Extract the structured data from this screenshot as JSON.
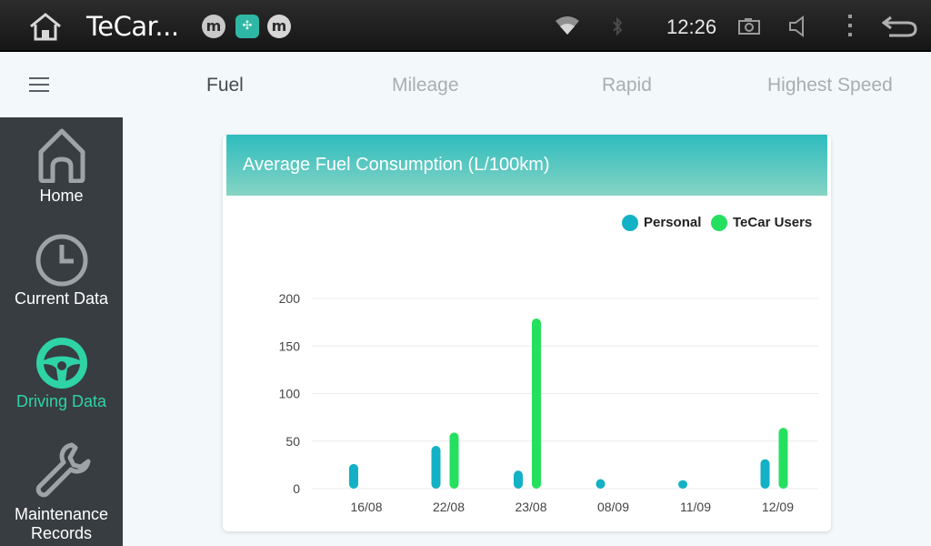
{
  "statusbar": {
    "title": "TeCar...",
    "time": "12:26",
    "notifications": [
      "m-badge-1",
      "m-badge-2",
      "m-badge-3"
    ],
    "icons": [
      "home-icon",
      "wifi-icon",
      "bluetooth-icon",
      "screenshot-icon",
      "volume-icon",
      "overflow-menu-icon",
      "back-icon"
    ]
  },
  "tabs": {
    "fuel": "Fuel",
    "mileage": "Mileage",
    "rapid": "Rapid",
    "highest_speed": "Highest Speed",
    "active": "Fuel"
  },
  "sidebar": {
    "items": [
      {
        "label": "Home",
        "icon": "house-icon"
      },
      {
        "label": "Current Data",
        "icon": "clock-icon"
      },
      {
        "label": "Driving Data",
        "icon": "steering-wheel-icon",
        "active": true
      },
      {
        "label": "Maintenance Records",
        "icon": "wrench-icon"
      }
    ],
    "active_color": "#2ed3a6"
  },
  "card": {
    "title": "Average Fuel Consumption (L/100km)"
  },
  "chart_data": {
    "type": "bar",
    "categories": [
      "16/08",
      "22/08",
      "23/08",
      "08/09",
      "11/09",
      "12/09"
    ],
    "series": [
      {
        "name": "Personal",
        "color": "#12b1c5",
        "values": [
          26,
          45,
          19,
          10,
          9,
          31
        ]
      },
      {
        "name": "TeCar Users",
        "color": "#25e05e",
        "values": [
          null,
          59,
          179,
          null,
          null,
          64
        ]
      }
    ],
    "ylim": [
      0,
      200
    ],
    "yticks": [
      0,
      50,
      100,
      150,
      200
    ],
    "grid": true,
    "legend": "top-right"
  }
}
